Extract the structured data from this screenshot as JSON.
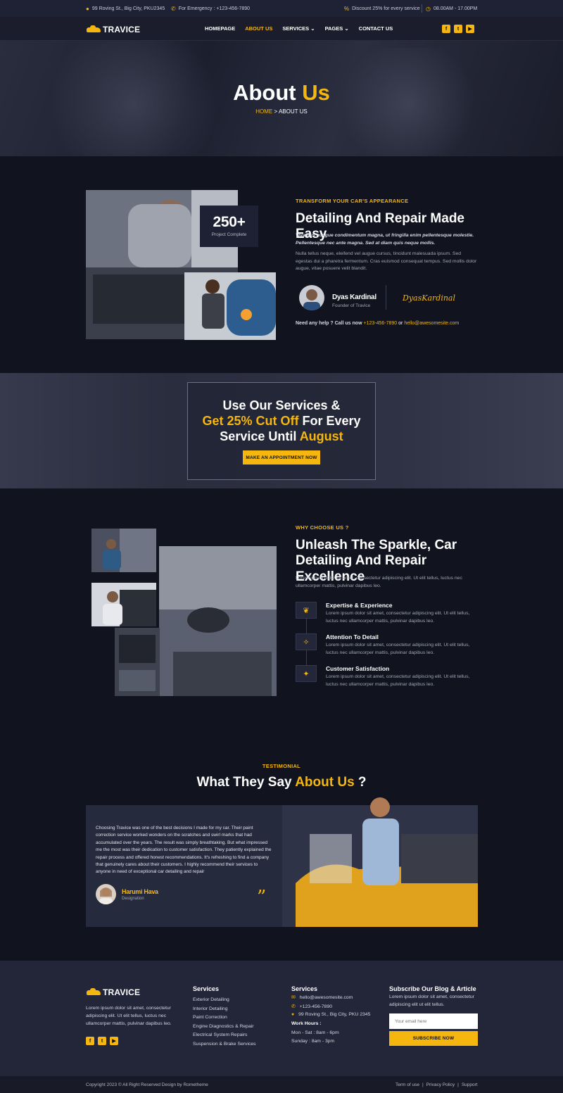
{
  "topbar": {
    "address": "99 Roving St., Big City, PKU2345",
    "emergency": "For Emergency : +123-456-7890",
    "discount": "Discount 25% for every service",
    "hours": "08.00AM - 17.00PM"
  },
  "nav": {
    "brand": "TRAVICE",
    "links": [
      "HOMEPAGE",
      "ABOUT US",
      "SERVICES",
      "PAGES",
      "CONTACT US"
    ],
    "social": [
      "f",
      "t",
      "▶"
    ]
  },
  "hero": {
    "title_a": "About",
    "title_b": "Us",
    "crumb_home": "HOME",
    "crumb_current": "> ABOUT US"
  },
  "about": {
    "stat_number": "250+",
    "stat_label": "Project Complete",
    "label": "TRANSFORM YOUR CAR'S APPEARANCE",
    "heading": "Detailing And Repair Made Easy",
    "lead": "Vivamus congue condimentum magna, ut fringilla enim pellentesque molestie. Pellentesque nec ante magna. Sed at diam quis neque mollis.",
    "body": "Nulla tellus neque, eleifend vel augue cursus, tincidunt malesuada ipsum. Sed egestas dui a pharetra fermentum. Cras euismod consequat tempus. Sed mollis dolor augue, vitae posuere velit blandit.",
    "founder_name": "Dyas Kardinal",
    "founder_role": "Founder of Travice",
    "signature": "DyasKardinal",
    "help_text": "Need any help ? Call us now",
    "help_phone": "+123-456-7890",
    "help_or": "or",
    "help_email": "hello@awesomesite.com"
  },
  "promo": {
    "line1": "Use Our Services &",
    "line2_accent": "Get 25% Cut Off",
    "line2_rest": "For Every",
    "line3_rest": "Service Until",
    "line3_accent": "August",
    "button": "MAKE AN APPOINTMENT NOW"
  },
  "why": {
    "label": "WHY CHOOSE US ?",
    "heading_1": "Unleash The Sparkle, Car",
    "heading_2": "Detailing And Repair Excellence",
    "body": "Lorem ipsum dolor sit amet, consectetur adipiscing elit. Ut elit tellus, luctus nec ullamcorper mattis, pulvinar dapibus leo.",
    "features": [
      {
        "title": "Expertise & Experience",
        "text": "Lorem ipsum dolor sit amet, consectetur adipiscing elit. Ut elit tellus, luctus nec ullamcorper mattis, pulvinar dapibus leo.",
        "icon": "laurel-icon"
      },
      {
        "title": "Attention To Detail",
        "text": "Lorem ipsum dolor sit amet, consectetur adipiscing elit. Ut elit tellus, luctus nec ullamcorper mattis, pulvinar dapibus leo.",
        "icon": "magic-wand-icon"
      },
      {
        "title": "Customer Satisfaction",
        "text": "Lorem ipsum dolor sit amet, consectetur adipiscing elit. Ut elit tellus, luctus nec ullamcorper mattis, pulvinar dapibus leo.",
        "icon": "hand-star-icon"
      }
    ]
  },
  "testimonial": {
    "label": "TESTIMONIAL",
    "heading_a": "What They Say",
    "heading_b": "About Us",
    "heading_c": "?",
    "quote": "Choosing Travice was one of the best decisions I made for my car. Their paint correction service worked wonders on the scratches and swirl marks that had accumulated over the years. The result was simply breathtaking. But what impressed me the most was their dedication to customer satisfaction. They patiently explained the repair process and offered honest recommendations. It's refreshing to find a company that genuinely cares about their customers. I highly recommend their services to anyone in need of exceptional car detailing and repair",
    "name": "Harumi Hava",
    "role": "Designation"
  },
  "footer": {
    "brand": "TRAVICE",
    "about": "Lorem ipsum dolor sit amet, consectetur adipiscing elit. Ut elit tellus, luctus nec ullamcorper mattis, pulvinar dapibus leo.",
    "services_title": "Services",
    "services": [
      "Exterior Detailing",
      "Interior Detailing",
      "Paint Correction",
      "Engine Diagnostics & Repair",
      "Electrical System Repairs",
      "Suspension & Brake Services"
    ],
    "contact_title": "Services",
    "email": "hello@awesomesite.com",
    "phone": "+123-456-7890",
    "address": "99 Roving St., Big City, PKU 2345",
    "hours_title": "Work Hours :",
    "hours_1": "Mon - Sat : 8am - 6pm",
    "hours_2": "Sunday : 8am - 3pm",
    "subscribe_title": "Subscribe Our Blog & Article",
    "subscribe_text": "Lorem ipsum dolor sit amet, consectetur adipiscing elit ut elit tellus.",
    "email_placeholder": "Your email here",
    "subscribe_button": "SUBSCRIBE NOW"
  },
  "copyright": {
    "text": "Copyright 2023 © All Right Reserved Design by Rometheme",
    "links": [
      "Term of use",
      "Privacy Policy",
      "Support"
    ]
  }
}
